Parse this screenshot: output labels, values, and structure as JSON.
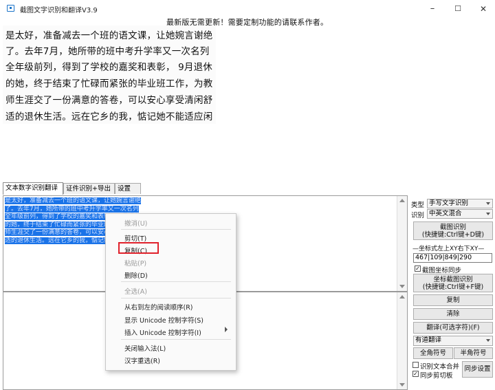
{
  "window": {
    "title": "截图文字识别和翻译V3.9",
    "minimize": "–",
    "maximize": "☐",
    "close": "✕"
  },
  "notice": "最新版无需更新！需要定制功能的请联系作者。",
  "captured_lines": [
    "是太好，准备减去一个班的语文课，让她婉言谢绝",
    "了。去年7月，她所带的班中考升学率又一次名列",
    "全年级前列，得到了学校的嘉奖和表彰， 9月退休",
    "的她，终于结束了忙碌而紧张的毕业班工作，为教",
    "师生涯交了一份满意的答卷，可以安心享受清闲舒",
    "适的退休生活。远在它乡的我，惦记她不能适应闲"
  ],
  "tabs": [
    "文本数字识别翻译",
    "证件识别+导出",
    "设置"
  ],
  "ocr_lines": [
    "是太好，准备减去一个班的语文课，让她婉言谢绝",
    "了。去年7月，她所带的班中考升学率又一次名列",
    "全年级前列，得到了学校的嘉奖和表彰， 9月退休",
    "的她，终于结束了忙碌而紧张的毕业班工作，为教",
    "师生涯交了一份满意的答卷，可以安心享受清闲舒",
    "适的退休生活。远在它乡的我，惦记她不能适应闲"
  ],
  "context_menu": {
    "undo": "撤消(U)",
    "cut": "剪切(T)",
    "copy": "复制(C)",
    "paste": "粘贴(P)",
    "delete": "删除(D)",
    "select_all": "全选(A)",
    "rtl": "从右到左的阅读顺序(R)",
    "show_unicode": "显示 Unicode 控制字符(S)",
    "insert_unicode": "插入 Unicode 控制字符(I)",
    "close_ime": "关闭输入法(L)",
    "reconvert": "汉字重选(R)"
  },
  "panel": {
    "type_label": "类型",
    "type_value": "手写文字识别",
    "ocr_label": "识别",
    "ocr_value": "中英文混合",
    "capture_btn_l1": "截图识别",
    "capture_btn_l2": "(快捷键:Ctrl键+D键)",
    "coords_label": "—坐标式左上XY右下XY—",
    "coords_value": "467|109|849|290",
    "sync_coords": "截图坐标同步",
    "coord_capture_l1": "坐标截图识别",
    "coord_capture_l2": "(快捷键:Ctrl键+F键)",
    "copy_btn": "复制",
    "clear_btn": "清除",
    "translate_btn": "翻译(可选字符)(F)",
    "translator_value": "有道翻译",
    "fullwidth_btn": "全角符号",
    "halfwidth_btn": "半角符号",
    "merge_text": "识别文本合并",
    "sync_clipboard": "同步剪切板",
    "sync_settings": "同步设置"
  }
}
